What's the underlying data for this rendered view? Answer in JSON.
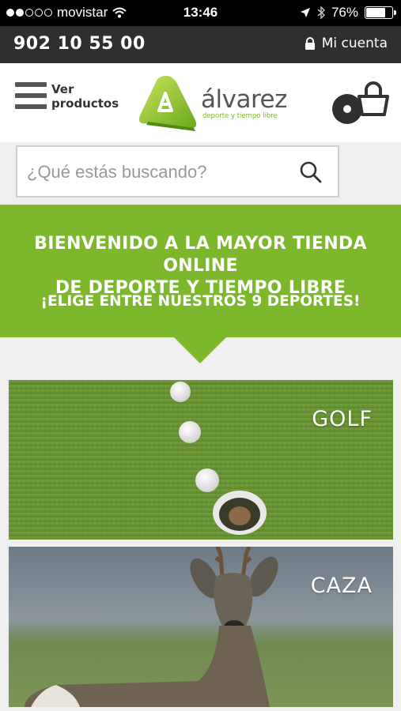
{
  "status_bar": {
    "carrier": "movistar",
    "time": "13:46",
    "battery": "76%",
    "battery_level": 0.76
  },
  "topbar": {
    "phone": "902 10 55 00",
    "account_label": "Mi cuenta"
  },
  "header": {
    "menu_label_line1": "Ver",
    "menu_label_line2": "productos",
    "logo_name": "álvarez",
    "logo_tagline": "deporte y tiempo libre"
  },
  "search": {
    "placeholder": "¿Qué estás buscando?"
  },
  "banner": {
    "title_line1": "BIENVENIDO A LA MAYOR TIENDA ONLINE",
    "title_line2": "DE DEPORTE Y TIEMPO LIBRE",
    "subtitle": "¡ELIGE ENTRE NUESTROS 9 DEPORTES!"
  },
  "categories": [
    {
      "label": "GOLF"
    },
    {
      "label": "CAZA"
    }
  ],
  "colors": {
    "brand_green": "#7cb72c",
    "topbar": "#2f2f2f"
  },
  "icons": [
    "wifi-icon",
    "location-arrow-icon",
    "bluetooth-icon",
    "battery-icon",
    "lock-icon",
    "hamburger-icon",
    "search-icon",
    "cart-icon"
  ]
}
